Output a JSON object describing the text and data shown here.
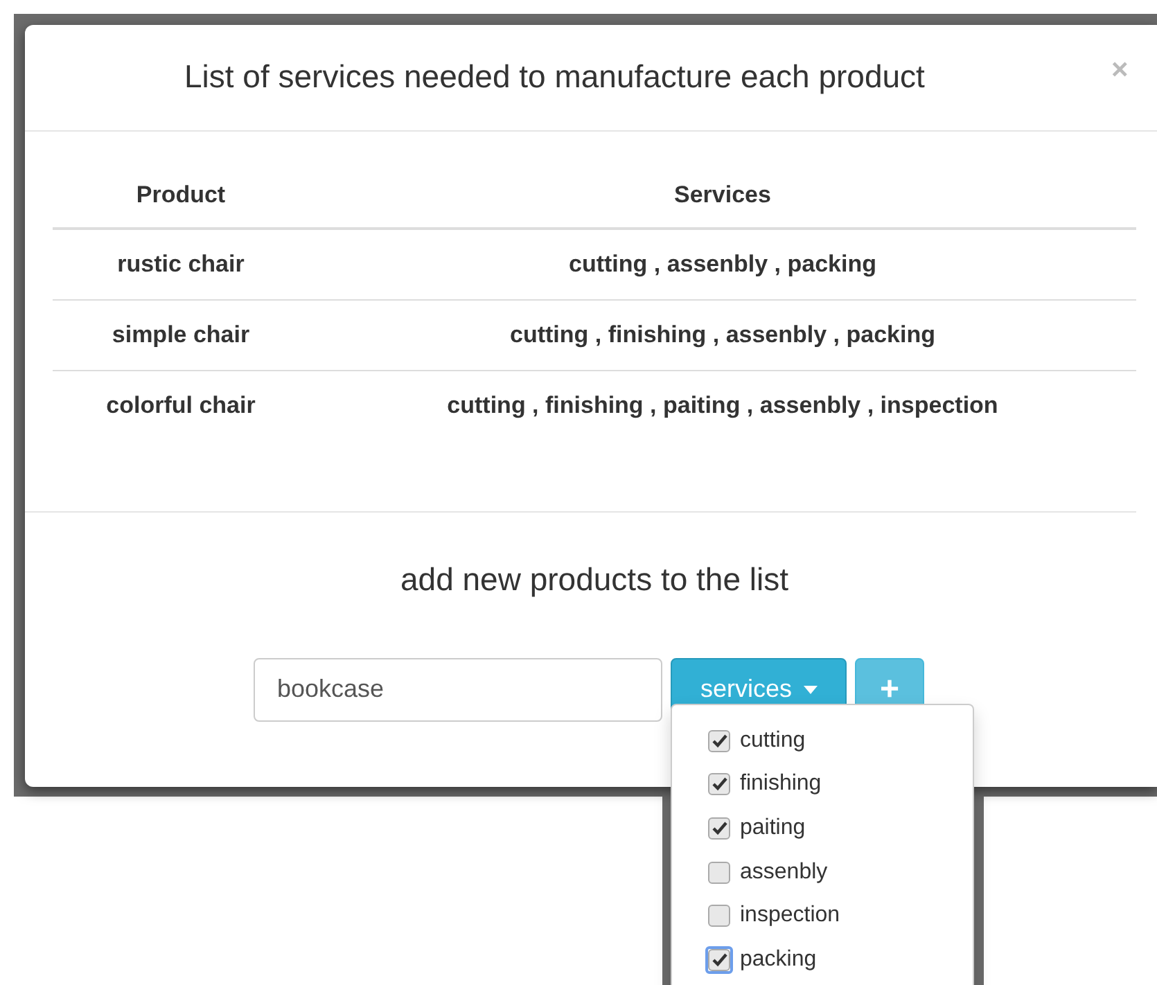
{
  "modal": {
    "title": "List of services needed to manufacture each product",
    "close": "×"
  },
  "table": {
    "columns": [
      "Product",
      "Services"
    ],
    "rows": [
      [
        "rustic chair",
        "cutting , assenbly , packing"
      ],
      [
        "simple chair",
        "cutting , finishing , assenbly , packing"
      ],
      [
        "colorful chair",
        "cutting , finishing , paiting , assenbly , inspection"
      ]
    ]
  },
  "add_form": {
    "heading": "add new products to the list",
    "product_value": "bookcase",
    "services_button": "services",
    "add_button": "+"
  },
  "services_menu": {
    "expanded": true,
    "items": [
      {
        "label": "cutting",
        "checked": true,
        "focused": false
      },
      {
        "label": "finishing",
        "checked": true,
        "focused": false
      },
      {
        "label": "paiting",
        "checked": true,
        "focused": false
      },
      {
        "label": "assenbly",
        "checked": false,
        "focused": false
      },
      {
        "label": "inspection",
        "checked": false,
        "focused": false
      },
      {
        "label": "packing",
        "checked": true,
        "focused": true
      }
    ]
  }
}
